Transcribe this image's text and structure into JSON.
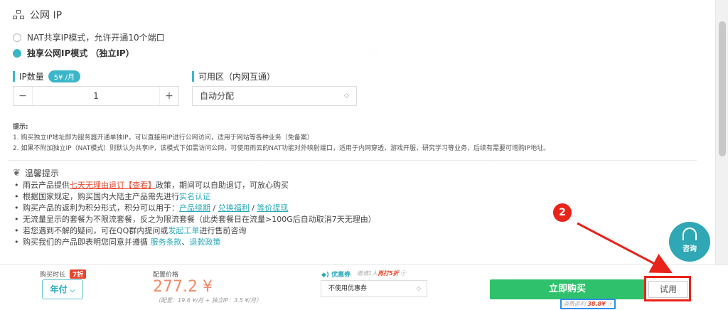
{
  "section": {
    "title": "公网 IP"
  },
  "ip_modes": [
    {
      "label": "NAT共享IP模式，允许开通10个端口",
      "selected": false
    },
    {
      "label": "独享公网IP模式 （独立IP）",
      "selected": true
    }
  ],
  "ip_count": {
    "label": "IP数量",
    "price_badge": "5¥ /月",
    "value": "1",
    "minus": "−",
    "plus": "+"
  },
  "zone": {
    "label": "可用区（内网互通）",
    "value": "自动分配"
  },
  "tips": {
    "title": "提示:",
    "lines": [
      "1. 购买独立IP地址即为服务器开通单独IP，可以直接用IP进行公网访问，适用于网站等各种业务（免备案）",
      "2. 如果不附加独立IP（NAT模式）则默认为共享IP，该模式下如需访问公网，可使用雨云的NAT功能对外映射端口，适用于内网穿透，游戏开服，研究学习等业务，后续有需要可增购IP地址。"
    ]
  },
  "notice": {
    "title": "温馨提示",
    "item1": {
      "a": "雨云产品提供",
      "link": "七天无理由退订【查看】",
      "b": "政策，期间可以自助退订，可放心购买"
    },
    "item2": {
      "a": "根据国家规定，购买国内大陆主产品需先进行",
      "link": "实名认证"
    },
    "item3": {
      "a": "购买产品的返利为积分形式，积分可以用于：",
      "l1": "产品续期",
      "sep1": " / ",
      "l2": "兑换福利",
      "sep2": " / ",
      "l3": "等价提现"
    },
    "item4": "无流量显示的套餐为不限流套餐，反之为限流套餐（此类套餐日在流量>100G后自动取消7天无理由）",
    "item5": {
      "a": "若您遇到不解的疑问，可在QQ群内提问或",
      "link": "发起工单",
      "b": "进行售前咨询"
    },
    "item6": {
      "a": "购买我们的产品即表明您同意并遵循 ",
      "l1": "服务条款",
      "sep": "、",
      "l2": "退款政策"
    }
  },
  "consult": {
    "label": "咨询"
  },
  "bottom": {
    "duration_label": "购买时长",
    "duration_discount": "7折",
    "duration_value": "年付",
    "price_label": "配置价格",
    "price": "277.2 ¥",
    "price_detail": "（配置：19.6 ¥/月 + 独立IP：3.5 ¥/月）",
    "coupon_label": "◆) 优惠券",
    "coupon_note_a": "邀请1人",
    "coupon_note_b": "再打5折",
    "coupon_value": "不使用优惠券",
    "buy_label": "立即购买",
    "try_label": "试用",
    "rebate_a": "消费返利",
    "rebate_b": "38.8¥"
  },
  "annotation": {
    "step": "2"
  },
  "colors": {
    "accent": "#3bb6c9",
    "buy": "#2fc16b",
    "alert": "#e8231a",
    "highlight": "#2e8fe8"
  }
}
